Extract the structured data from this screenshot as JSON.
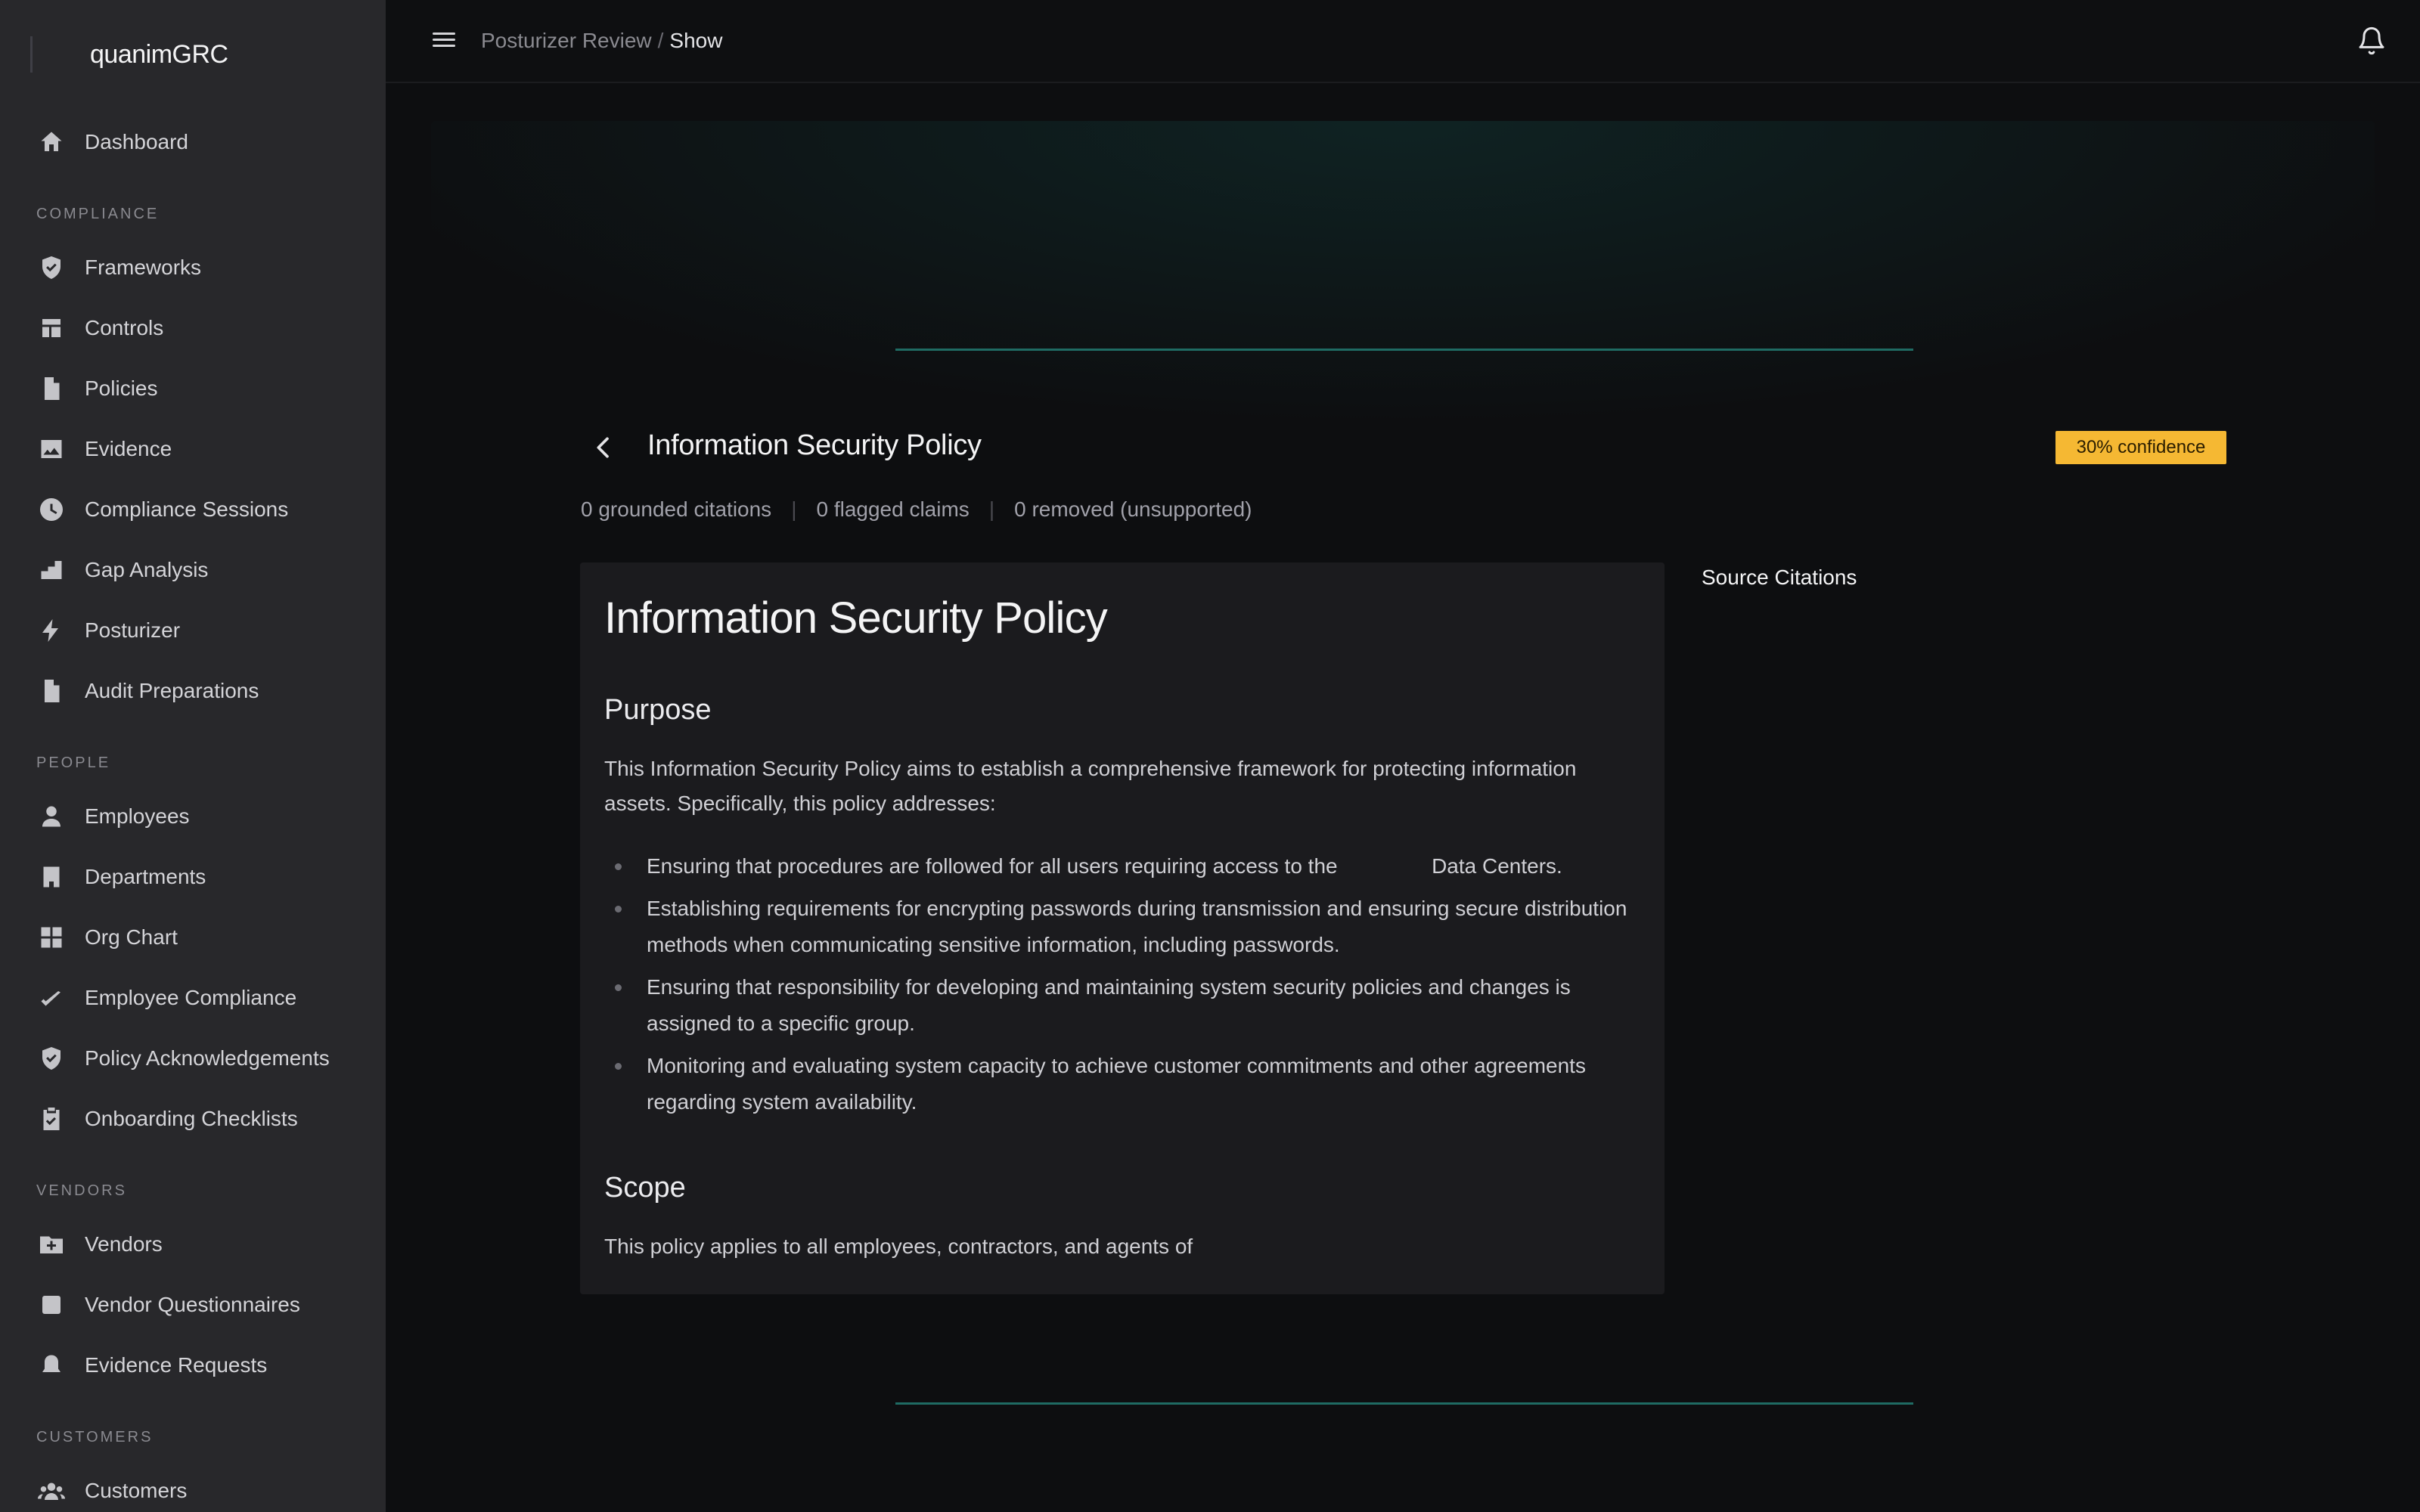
{
  "app": {
    "name": "quanimGRC"
  },
  "sidebar": {
    "top_items": [
      {
        "label": "Dashboard",
        "icon": "home-icon"
      }
    ],
    "sections": [
      {
        "title": "COMPLIANCE",
        "items": [
          {
            "label": "Frameworks",
            "icon": "shield-check-icon"
          },
          {
            "label": "Controls",
            "icon": "layout-icon"
          },
          {
            "label": "Policies",
            "icon": "document-icon"
          },
          {
            "label": "Evidence",
            "icon": "image-icon"
          },
          {
            "label": "Compliance Sessions",
            "icon": "clock-icon"
          },
          {
            "label": "Gap Analysis",
            "icon": "bar-steps-icon"
          },
          {
            "label": "Posturizer",
            "icon": "lightning-icon"
          },
          {
            "label": "Audit Preparations",
            "icon": "document-icon"
          }
        ]
      },
      {
        "title": "PEOPLE",
        "items": [
          {
            "label": "Employees",
            "icon": "user-icon"
          },
          {
            "label": "Departments",
            "icon": "building-icon"
          },
          {
            "label": "Org Chart",
            "icon": "grid-icon"
          },
          {
            "label": "Employee Compliance",
            "icon": "check-icon"
          },
          {
            "label": "Policy Acknowledgements",
            "icon": "shield-check-icon"
          },
          {
            "label": "Onboarding Checklists",
            "icon": "clipboard-check-icon"
          }
        ]
      },
      {
        "title": "VENDORS",
        "items": [
          {
            "label": "Vendors",
            "icon": "folder-plus-icon"
          },
          {
            "label": "Vendor Questionnaires",
            "icon": "square-icon"
          },
          {
            "label": "Evidence Requests",
            "icon": "bell-icon"
          }
        ]
      },
      {
        "title": "CUSTOMERS",
        "items": [
          {
            "label": "Customers",
            "icon": "users-icon"
          }
        ]
      }
    ]
  },
  "topbar": {
    "breadcrumb_parent": "Posturizer Review",
    "breadcrumb_sep": "/",
    "breadcrumb_current": "Show"
  },
  "review": {
    "title": "Information Security Policy",
    "confidence": "30% confidence",
    "stats": [
      "0 grounded citations",
      "0 flagged claims",
      "0 removed (unsupported)"
    ],
    "stat_sep": "|",
    "source_citations_label": "Source Citations"
  },
  "document": {
    "heading": "Information Security Policy",
    "purpose_heading": "Purpose",
    "purpose_text": "This Information Security Policy aims to establish a comprehensive framework for protecting information assets. Specifically, this policy addresses:",
    "bullets": [
      "Ensuring that procedures are followed for all users requiring access to the                Data Centers.",
      "Establishing requirements for encrypting passwords during transmission and ensuring secure distribution methods when communicating sensitive information, including passwords.",
      "Ensuring that responsibility for developing and maintaining system security policies and changes is assigned to a specific group.",
      "Monitoring and evaluating system capacity to achieve customer commitments and other agreements regarding system availability."
    ],
    "scope_heading": "Scope",
    "scope_text": "This policy applies to all employees, contractors, and agents of"
  },
  "colors": {
    "sidebar_bg": "#28282b",
    "main_bg": "#0d0e10",
    "accent_line": "#1f6b63",
    "badge_bg": "#f5b833"
  }
}
